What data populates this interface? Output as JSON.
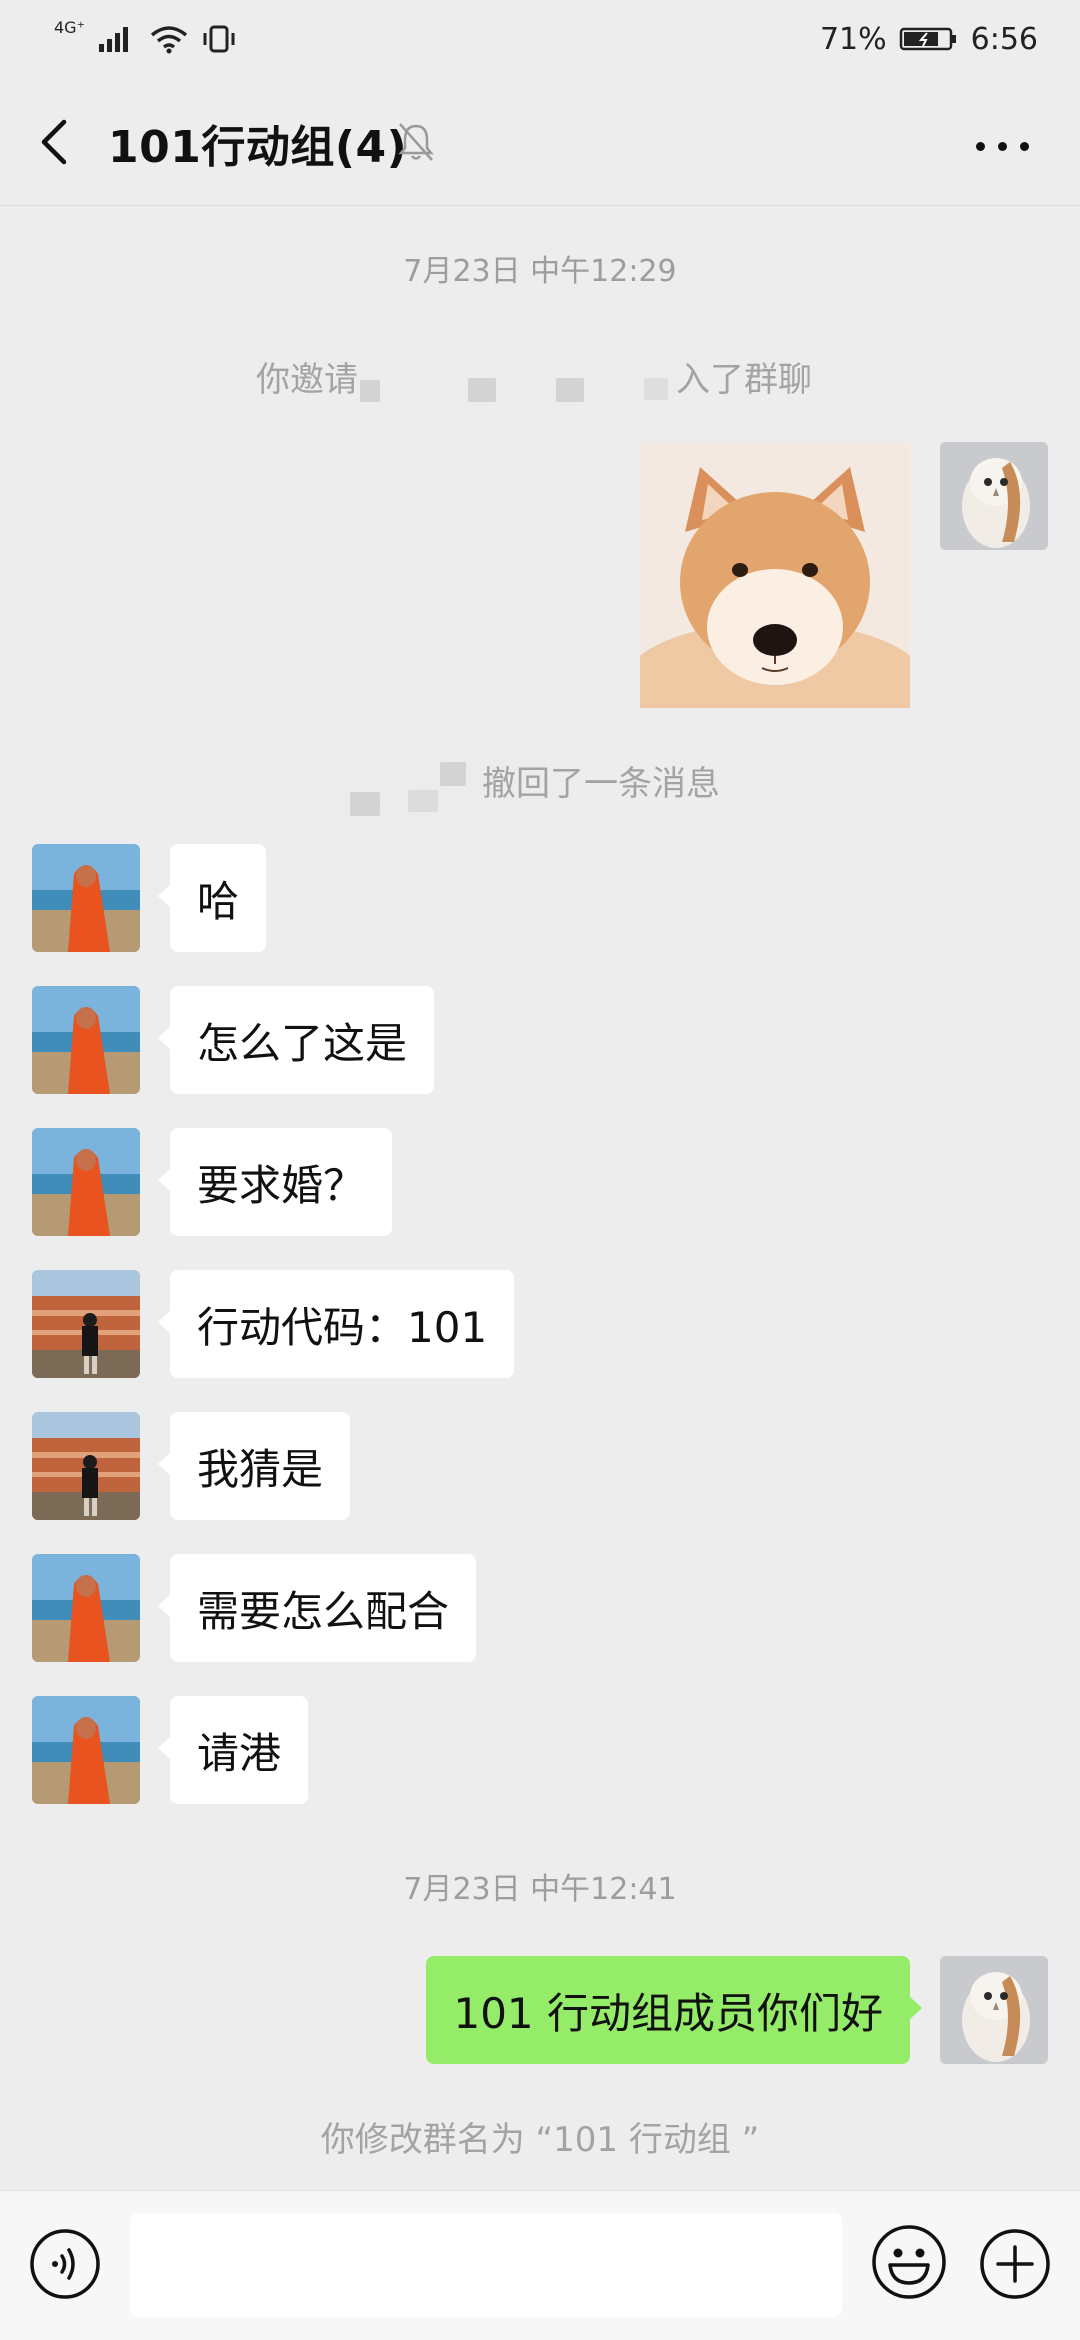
{
  "status_bar": {
    "network": "4G⁺",
    "battery": "71%",
    "time": "6:56"
  },
  "nav": {
    "title": "101行动组(4)",
    "back_icon": "chevron-left-icon",
    "mute_icon": "bell-off-icon",
    "more_icon": "more-dots-icon"
  },
  "messages": {
    "timestamp_1": "7月23日 中午12:29",
    "invite_prefix": "你邀请",
    "invite_suffix": "入了群聊",
    "recall_text": "撤回了一条消息",
    "msg_1": "哈",
    "msg_2": "怎么了这是",
    "msg_3": "要求婚？",
    "msg_4": "行动代码：101",
    "msg_5": "我猜是",
    "msg_6": "需要怎么配合",
    "msg_7": "请港",
    "timestamp_2": "7月23日 中午12:41",
    "my_msg": "101 行动组成员你们好",
    "rename_notice": "你修改群名为 “101 行动组 ”"
  },
  "input_bar": {
    "voice_icon": "voice-icon",
    "emoji_icon": "emoji-icon",
    "plus_icon": "plus-circle-icon",
    "placeholder": ""
  },
  "colors": {
    "background": "#ededed",
    "my_bubble": "#95ec69",
    "other_bubble": "#ffffff",
    "system_text": "#a3a3a3"
  }
}
